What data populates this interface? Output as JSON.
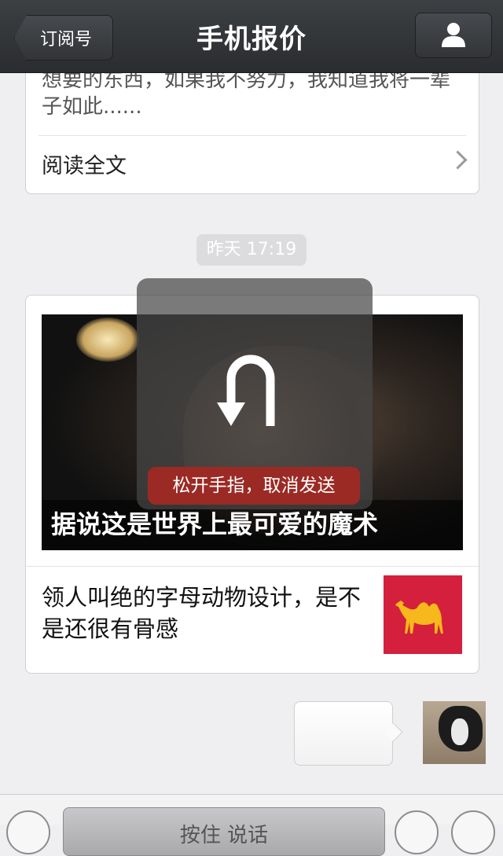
{
  "nav": {
    "back_label": "订阅号",
    "title": "手机报价"
  },
  "card1": {
    "excerpt": "想要的东西，如果我不努力，我知道我将一辈子如此......",
    "read_more": "阅读全文"
  },
  "timestamp": "昨天 17:19",
  "card2": {
    "hero_title": "据说这是世界上最可爱的魔术",
    "sub_title": "领人叫绝的字母动物设计，是不是还很有骨感"
  },
  "overlay": {
    "message": "松开手指，取消发送"
  },
  "bottom": {
    "hold_label": "按住 说话"
  },
  "colors": {
    "cancel_red": "#9b2a25",
    "thumb_red": "#d4203c",
    "camel": "#f6b81a"
  }
}
